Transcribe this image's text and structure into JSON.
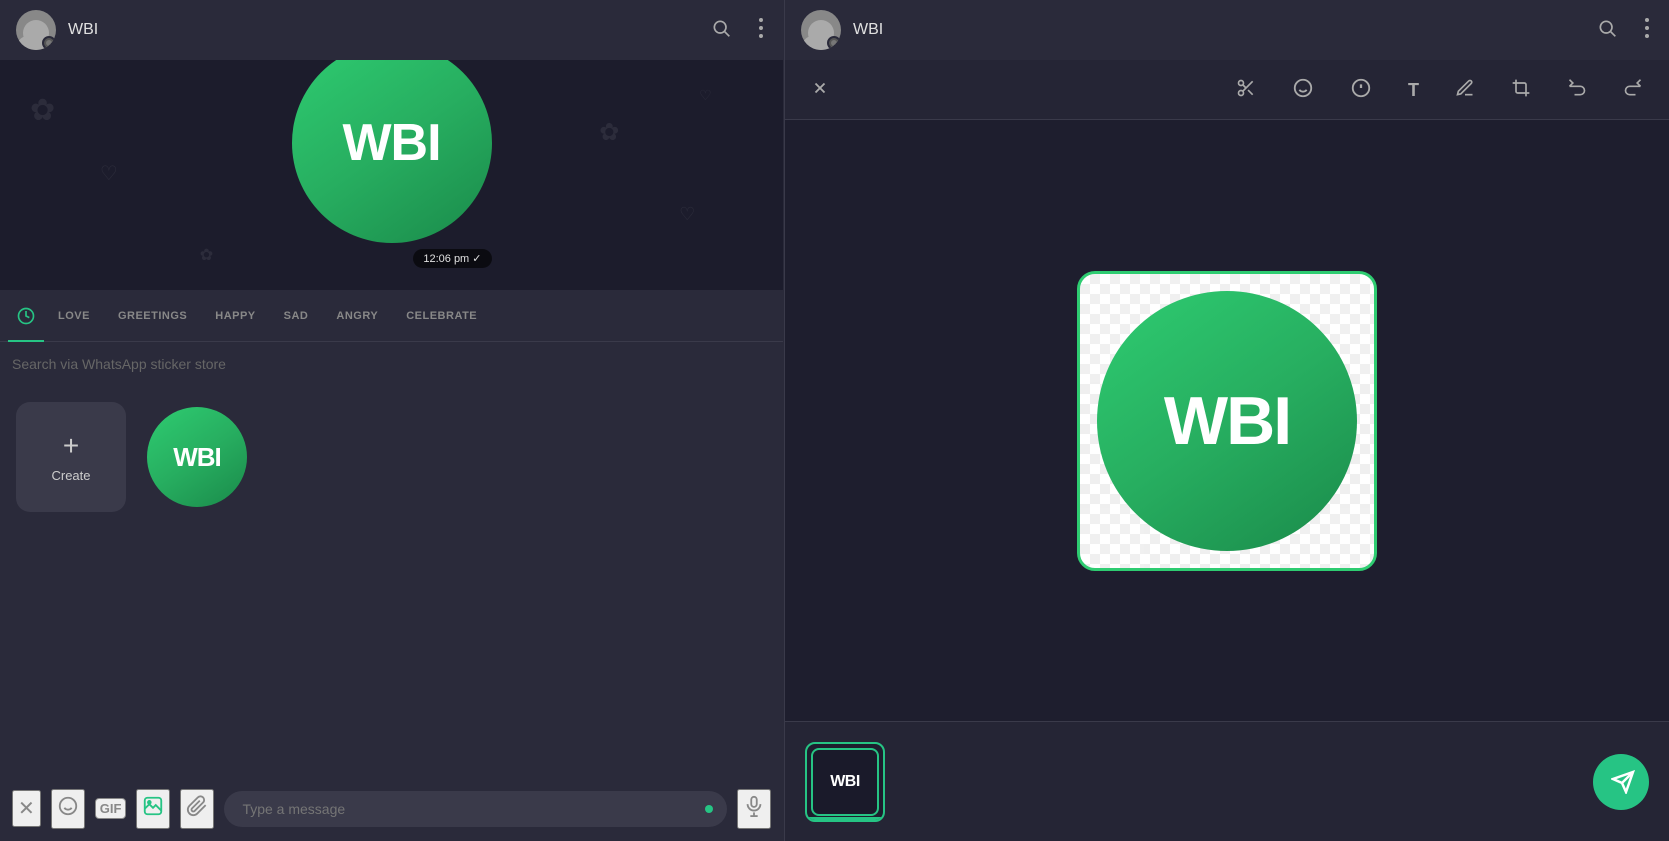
{
  "left": {
    "topbar": {
      "title": "WBI",
      "search_icon": "🔍",
      "more_icon": "⋮"
    },
    "timestamp": "12:06 pm ✓",
    "tabs": {
      "clock_icon": "🕐",
      "items": [
        {
          "label": "LOVE"
        },
        {
          "label": "GREETINGS"
        },
        {
          "label": "HAPPY"
        },
        {
          "label": "SAD"
        },
        {
          "label": "ANGRY"
        },
        {
          "label": "CELEBRATE"
        }
      ]
    },
    "search_placeholder": "Search via WhatsApp sticker store",
    "create_label": "Create",
    "wbi_logo": "WBI",
    "bottombar": {
      "type_placeholder": "Type a message"
    }
  },
  "right": {
    "topbar": {
      "title": "WBI",
      "search_icon": "🔍",
      "more_icon": "⋮"
    },
    "editor": {
      "close_icon": "✕",
      "scissors_icon": "✂",
      "emoji_icon": "☺",
      "sticker_icon": "⊕",
      "text_icon": "T",
      "pen_icon": "✏",
      "crop_icon": "⊡",
      "undo_icon": "↩",
      "redo_icon": "↪",
      "wbi_text": "WBI",
      "thumb_text": "WBI"
    }
  }
}
